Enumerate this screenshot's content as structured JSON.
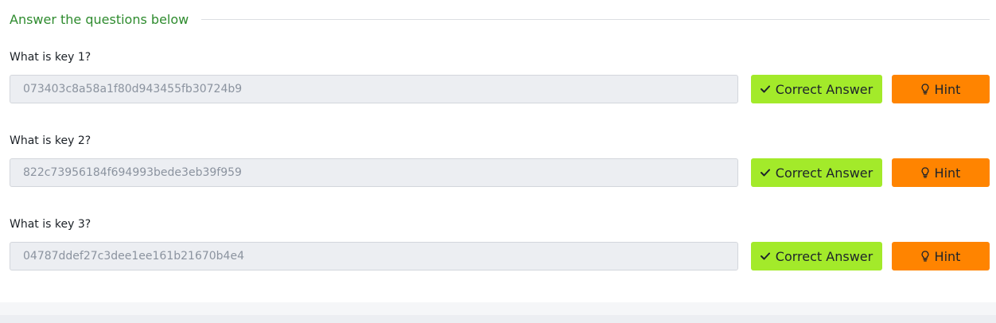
{
  "section": {
    "title": "Answer the questions below"
  },
  "questions": [
    {
      "label": "What is key 1?",
      "answer": "073403c8a58a1f80d943455fb30724b9",
      "correct_label": "Correct Answer",
      "hint_label": "Hint"
    },
    {
      "label": "What is key 2?",
      "answer": "822c73956184f694993bede3eb39f959",
      "correct_label": "Correct Answer",
      "hint_label": "Hint"
    },
    {
      "label": "What is key 3?",
      "answer": "04787ddef27c3dee1ee161b21670b4e4",
      "correct_label": "Correct Answer",
      "hint_label": "Hint"
    }
  ],
  "icons": {
    "correct": "checkmark-icon",
    "hint": "lightbulb-icon"
  },
  "colors": {
    "section_title": "#2e8b2e",
    "correct_button": "#a3ea2a",
    "hint_button": "#ff8400",
    "input_background": "#eceef2"
  }
}
